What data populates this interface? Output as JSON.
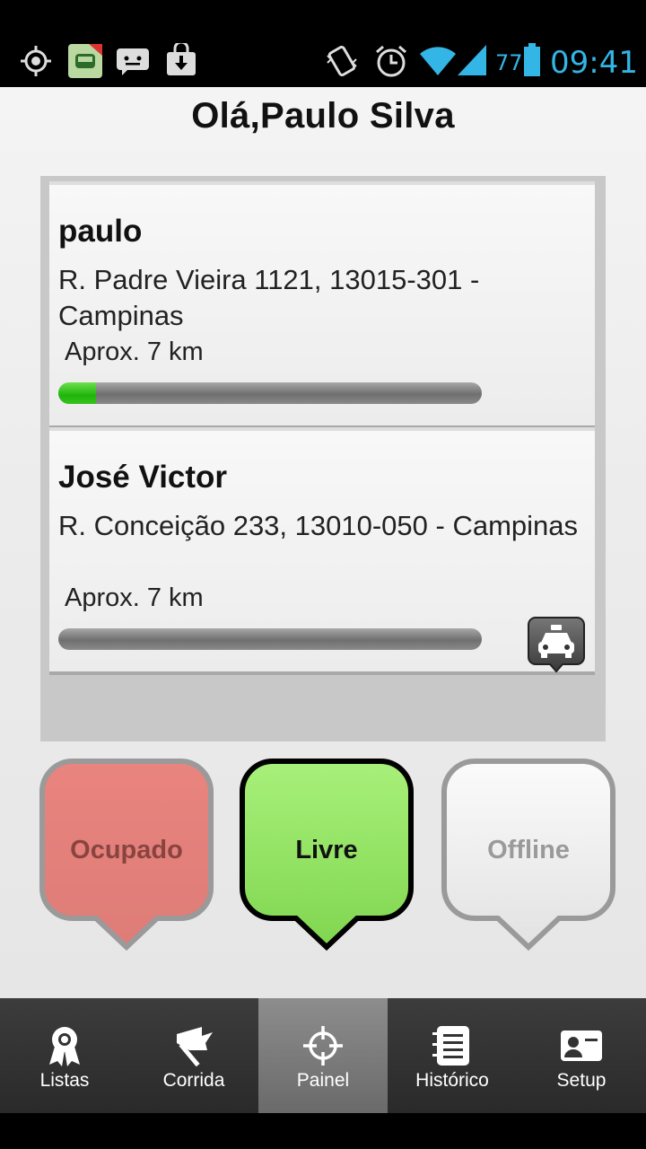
{
  "status_bar": {
    "battery_level": "77",
    "time": "09:41",
    "accent_color": "#33b5e5"
  },
  "greeting": "Olá,Paulo Silva",
  "requests": [
    {
      "name": "paulo",
      "address": "R. Padre Vieira 1121, 13015-301 - Campinas",
      "distance": "Aprox. 7 km",
      "progress_fraction": 0.09
    },
    {
      "name": "José Victor",
      "address": "R. Conceição 233, 13010-050 - Campinas",
      "distance": "Aprox. 7 km",
      "progress_fraction": 0,
      "icon": "taxi-icon"
    }
  ],
  "status_buttons": {
    "busy": {
      "label": "Ocupado",
      "color": "#e07b75"
    },
    "free": {
      "label": "Livre",
      "color": "#8fe05a"
    },
    "offline": {
      "label": "Offline",
      "color": "#efefef"
    }
  },
  "nav": [
    {
      "label": "Listas",
      "icon": "award-icon"
    },
    {
      "label": "Corrida",
      "icon": "flag-icon"
    },
    {
      "label": "Painel",
      "icon": "crosshair-icon",
      "active": true
    },
    {
      "label": "Histórico",
      "icon": "notebook-icon"
    },
    {
      "label": "Setup",
      "icon": "contact-card-icon"
    }
  ]
}
